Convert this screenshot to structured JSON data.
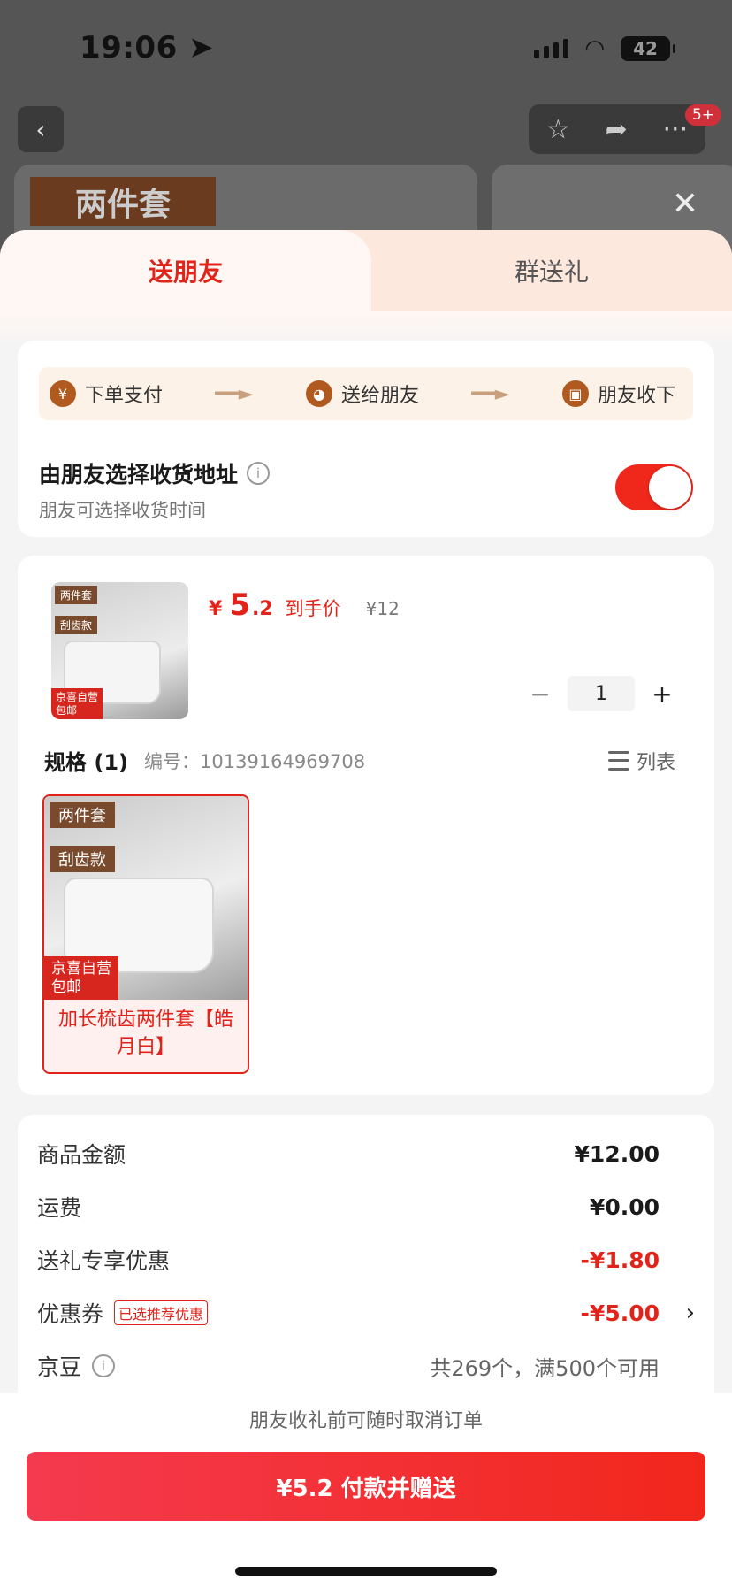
{
  "status_bar": {
    "time": "19:06",
    "battery": "42"
  },
  "background": {
    "tag": "两件套",
    "badge": "5+"
  },
  "tabs": [
    {
      "label": "送朋友",
      "active": true
    },
    {
      "label": "群送礼",
      "active": false
    }
  ],
  "flow": {
    "steps": [
      {
        "icon": "yen-icon",
        "label": "下单支付"
      },
      {
        "icon": "wechat-icon",
        "label": "送给朋友"
      },
      {
        "icon": "gift-icon",
        "label": "朋友收下"
      }
    ]
  },
  "address": {
    "title": "由朋友选择收货地址",
    "subtitle": "朋友可选择收货时间",
    "toggle_on": true
  },
  "product": {
    "thumb_tag": "两件套",
    "thumb_tag2": "刮齿款",
    "thumb_badge_line1": "京喜自营",
    "thumb_badge_line2": "包邮",
    "price_currency": "¥",
    "price_int": "5",
    "price_dec": ".2",
    "price_label": "到手价",
    "original_price": "¥12",
    "quantity": "1"
  },
  "spec": {
    "label": "规格 (1)",
    "code": "编号：10139164969708",
    "list_label": "列表",
    "option_name": "加长梳齿两件套【皓月白】",
    "option_tag": "两件套",
    "option_tag2": "刮齿款",
    "option_badge_line1": "京喜自营",
    "option_badge_line2": "包邮"
  },
  "fees": [
    {
      "label": "商品金额",
      "value": "¥12.00",
      "style": "normal"
    },
    {
      "label": "运费",
      "value": "¥0.00",
      "style": "normal"
    },
    {
      "label": "送礼专享优惠",
      "value": "-¥1.80",
      "style": "red"
    },
    {
      "label": "优惠券",
      "tag": "已选推荐优惠",
      "value": "-¥5.00",
      "style": "red"
    },
    {
      "label": "京豆",
      "value": "共269个，满500个可用",
      "style": "muted"
    }
  ],
  "footer": {
    "note": "朋友收礼前可随时取消订单",
    "pay_button": "¥5.2 付款并赠送"
  },
  "colors": {
    "accent": "#e2231a",
    "flow_icon": "#b05a1f",
    "toggle": "#f0281c"
  }
}
